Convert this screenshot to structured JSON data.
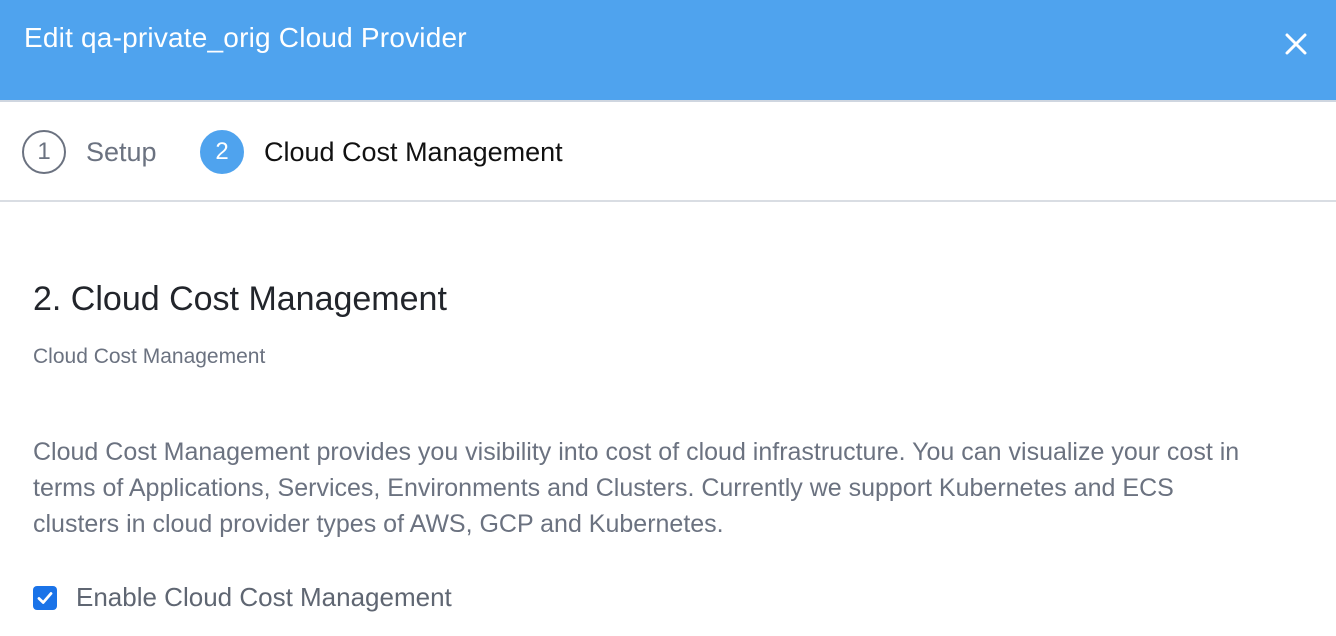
{
  "header": {
    "title": "Edit qa-private_orig Cloud Provider",
    "close_icon": "close-icon"
  },
  "steps": [
    {
      "number": "1",
      "label": "Setup",
      "state": "inactive"
    },
    {
      "number": "2",
      "label": "Cloud Cost Management",
      "state": "active"
    }
  ],
  "section": {
    "title": "2. Cloud Cost Management",
    "subtitle": "Cloud Cost Management",
    "description": "Cloud Cost Management provides you visibility into cost of cloud infrastructure. You can visualize your cost in terms of Applications, Services, Environments and Clusters. Currently we support Kubernetes and ECS clusters in cloud provider types of AWS, GCP and Kubernetes.",
    "checkbox": {
      "label": "Enable Cloud Cost Management",
      "checked": true
    }
  },
  "colors": {
    "header_bg": "#4fa3ee",
    "active_step": "#4fa3ee",
    "checkbox": "#1a73e8"
  }
}
